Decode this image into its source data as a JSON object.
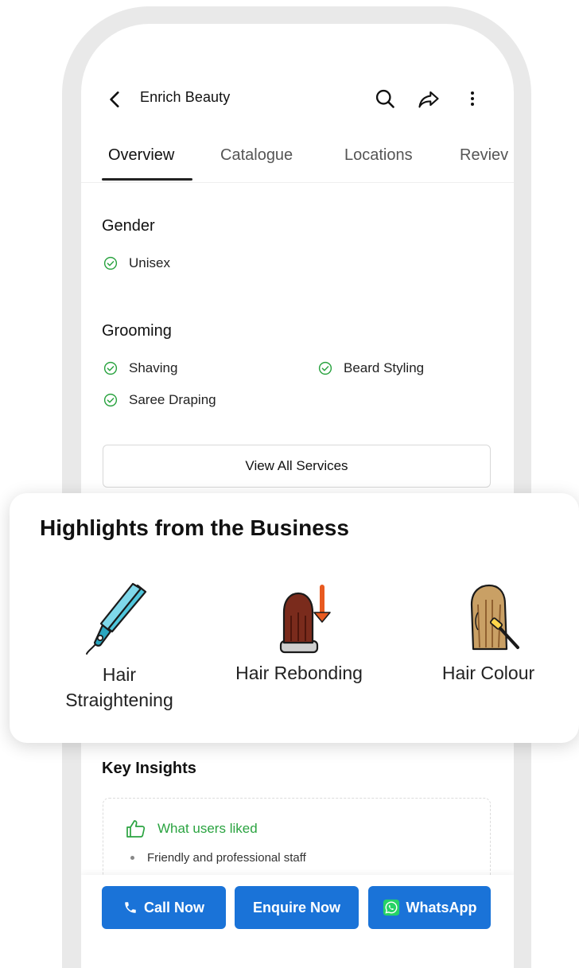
{
  "header": {
    "title": "Enrich Beauty",
    "back_icon": "chevron-left-icon",
    "search_icon": "search-icon",
    "share_icon": "share-icon",
    "more_icon": "more-vertical-icon"
  },
  "tabs": [
    {
      "label": "Overview",
      "active": true
    },
    {
      "label": "Catalogue",
      "active": false
    },
    {
      "label": "Locations",
      "active": false
    },
    {
      "label": "Reviev",
      "active": false
    }
  ],
  "gender": {
    "title": "Gender",
    "items": [
      "Unisex"
    ]
  },
  "grooming": {
    "title": "Grooming",
    "items": [
      "Shaving",
      "Beard Styling",
      "Saree Draping"
    ]
  },
  "view_all_label": "View All Services",
  "highlights": {
    "title": "Highlights from the Business",
    "items": [
      {
        "label_line1": "Hair",
        "label_line2": "Straightening",
        "icon": "hair-straightener-icon"
      },
      {
        "label_line1": "Hair Rebonding",
        "label_line2": "",
        "icon": "hair-rebonding-icon"
      },
      {
        "label_line1": "Hair Colour",
        "label_line2": "",
        "icon": "hair-colour-icon"
      }
    ]
  },
  "key_insights": {
    "title": "Key Insights",
    "liked_label": "What users liked",
    "liked_items": [
      "Friendly and professional staff"
    ]
  },
  "actions": {
    "call_label": "Call Now",
    "enquire_label": "Enquire Now",
    "whatsapp_label": "WhatsApp"
  },
  "colors": {
    "primary_blue": "#1a73d8",
    "check_green": "#2aa340",
    "whatsapp_green": "#25d366"
  }
}
